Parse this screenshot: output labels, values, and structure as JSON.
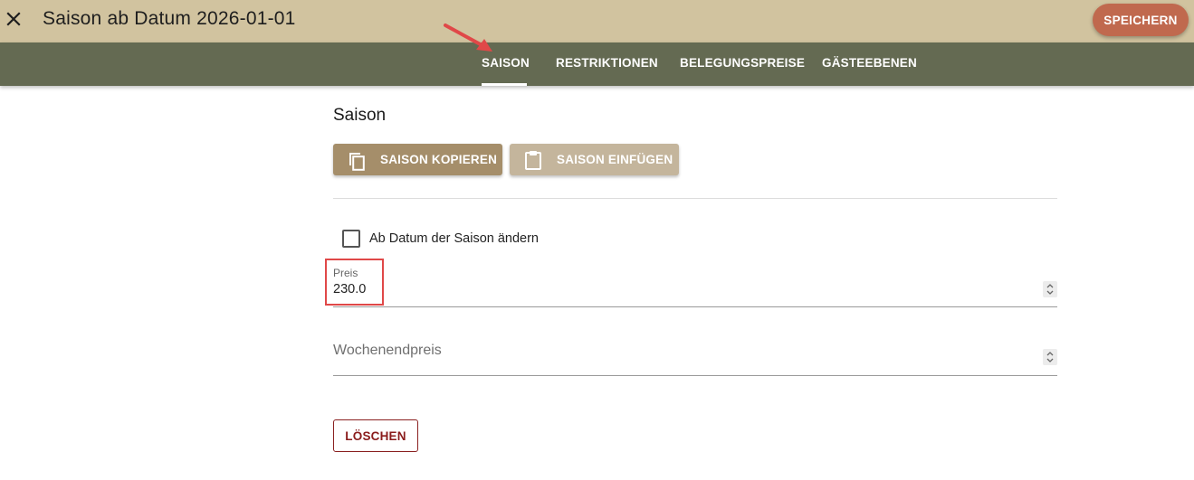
{
  "header": {
    "title": "Saison ab Datum 2026-01-01",
    "close_icon": "close-icon",
    "save_label": "SPEICHERN"
  },
  "tabs": [
    {
      "label": "SAISON",
      "active": true
    },
    {
      "label": "RESTRIKTIONEN",
      "active": false
    },
    {
      "label": "BELEGUNGSPREISE",
      "active": false
    },
    {
      "label": "GÄSTEEBENEN",
      "active": false
    }
  ],
  "section": {
    "title": "Saison",
    "copy_button": {
      "label": "SAISON KOPIEREN",
      "icon": "copy-icon"
    },
    "paste_button": {
      "label": "SAISON EINFÜGEN",
      "icon": "clipboard-icon"
    },
    "checkbox": {
      "label": "Ab Datum der Saison ändern",
      "checked": false
    },
    "preis": {
      "label": "Preis",
      "value": "230.0"
    },
    "wochenendpreis": {
      "placeholder": "Wochenendpreis",
      "value": ""
    },
    "delete_label": "LÖSCHEN"
  },
  "colors": {
    "header_bg": "#d1c39f",
    "tabbar_bg": "#646a52",
    "save_button": "#c0694e",
    "copy_button": "#a58e6a",
    "paste_button": "#c4b59c",
    "delete_text": "#8a1c1c",
    "annotation": "#e04848"
  }
}
